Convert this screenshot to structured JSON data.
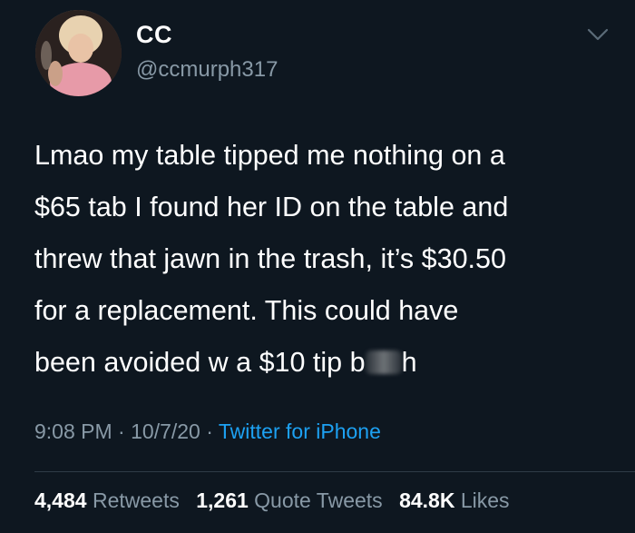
{
  "author": {
    "display_name": "CC",
    "handle": "@ccmurph317"
  },
  "tweet": {
    "lines": [
      "Lmao my table tipped me nothing on a",
      "$65 tab I found her ID on the table and",
      "threw that jawn in the trash, it’s $30.50",
      "for a replacement. This could have"
    ],
    "last_line_before": "been avoided w a $10 tip b",
    "last_line_after": "h"
  },
  "meta": {
    "time": "9:08 PM",
    "date": "10/7/20",
    "separator": "·",
    "source": "Twitter for iPhone"
  },
  "stats": {
    "retweets_count": "4,484",
    "retweets_label": "Retweets",
    "quotes_count": "1,261",
    "quotes_label": "Quote Tweets",
    "likes_count": "84.8K",
    "likes_label": "Likes"
  },
  "icons": {
    "menu": "chevron-down-icon"
  },
  "colors": {
    "background": "#0e1720",
    "text": "#ffffff",
    "secondary": "#8899a6",
    "link": "#1da1f2"
  }
}
